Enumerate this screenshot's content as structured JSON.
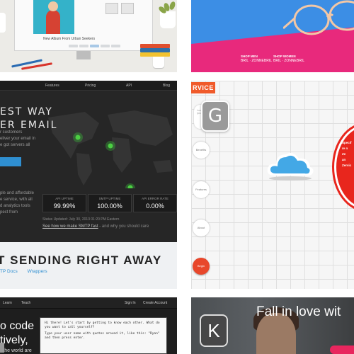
{
  "album": {
    "title": "New Album From Urban Seekers"
  },
  "glasses_shop": {
    "links": [
      {
        "heading": "SHOP MEN",
        "sub": "BRIL · ZONNEBRIL"
      },
      {
        "heading": "SHOP WOMEN",
        "sub": "BRIL · ZONNEBRIL"
      }
    ]
  },
  "smtp": {
    "nav": [
      "Features",
      "Pricing",
      "API",
      "Blog"
    ],
    "hero_line1": "EST WAY",
    "hero_line2": "ER EMAIL",
    "lines_a": [
      "r customers",
      "eliver your email in",
      "e got servers all"
    ],
    "lines_b": [
      "ple and affordable",
      "e service, with all",
      "d analytics tools",
      "pect from"
    ],
    "stats": [
      {
        "label": "API UPTIME",
        "value": "99.99%"
      },
      {
        "label": "SMTP UPTIME",
        "value": "100.00%"
      },
      {
        "label": "API ERROR RATE",
        "value": "0.00%"
      }
    ],
    "status_updated": "Status Updated: July 30, 2013 01:20 PM Eastern",
    "read_link": "See how we make SMTP fast",
    "read_suffix": " - and why you should care",
    "big_heading": "T SENDING RIGHT AWAY",
    "doc_links": [
      "TP Docs",
      "Wrappers"
    ]
  },
  "cloud": {
    "ribbon": "RVICE",
    "g_letter": "G",
    "g_caption": "Lorem Ipsum",
    "side_buttons": [
      "Benefits",
      "Features",
      "About"
    ],
    "begin": "Begin",
    "disc_lines": [
      "Specif",
      "re n",
      "Ze",
      "an",
      "Zervic"
    ]
  },
  "code": {
    "nav": [
      "Learn",
      "Teach",
      "Sign In",
      "Create Account"
    ],
    "heading1": "o code",
    "heading2": "tively,",
    "sub": "r the world are",
    "terminal": [
      "Hi there! Let's start by getting to know each other. What do you want to call yourself?",
      "Type your user name with quotes around it, like this: \"Ryan\" and then press enter."
    ]
  },
  "video": {
    "k_letter": "K",
    "tagline": "Fall in love wit"
  }
}
